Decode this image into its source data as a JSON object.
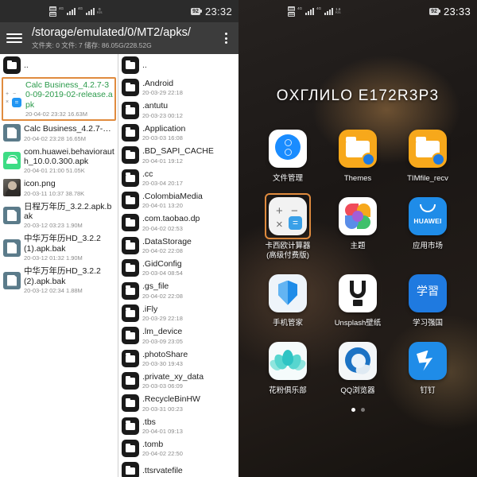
{
  "left_phone": {
    "status_bar": {
      "net_label_1": "4G",
      "net_label_2": "4G",
      "speed_value": "0",
      "speed_unit": "K/s",
      "battery": "92",
      "clock": "23:32"
    },
    "toolbar": {
      "menu_icon": "hamburger-icon",
      "path": "/storage/emulated/0/MT2/apks/",
      "subtitle": "文件夹: 0  文件: 7  储存: 86.05G/228.52G",
      "overflow_icon": "kebab-menu-icon"
    },
    "left_pane": {
      "items": [
        {
          "icon": "folder-icon",
          "icon_type": "folder",
          "name": "..",
          "date": "",
          "selected": false,
          "green": false
        },
        {
          "icon": "calculator-icon",
          "icon_type": "calc",
          "name": "Calc Business_4.2.7-30-09-2019-02-release.apk",
          "date": "20-04-02 23:32  16.63M",
          "selected": true,
          "green": true
        },
        {
          "icon": "document-icon",
          "icon_type": "doc",
          "name": "Calc Business_4.2.7-30-09...",
          "date": "20-04-02 23:28  16.65M",
          "selected": false,
          "green": false
        },
        {
          "icon": "android-apk-icon",
          "icon_type": "apk",
          "name": "com.huawei.behaviorauth_10.0.0.300.apk",
          "date": "20-04-01 21:00  51.05K",
          "selected": false,
          "green": false
        },
        {
          "icon": "image-icon",
          "icon_type": "img",
          "name": "icon.png",
          "date": "20-03-11 10:37  38.78K",
          "selected": false,
          "green": false
        },
        {
          "icon": "document-icon",
          "icon_type": "doc",
          "name": "日程万年历_3.2.2.apk.bak",
          "date": "20-03-12 03:23  1.90M",
          "selected": false,
          "green": false
        },
        {
          "icon": "document-icon",
          "icon_type": "doc",
          "name": "中华万年历HD_3.2.2 (1).apk.bak",
          "date": "20-03-12 01:32  1.90M",
          "selected": false,
          "green": false
        },
        {
          "icon": "document-icon",
          "icon_type": "doc",
          "name": "中华万年历HD_3.2.2 (2).apk.bak",
          "date": "20-03-12 02:34  1.88M",
          "selected": false,
          "green": false
        }
      ]
    },
    "right_pane": {
      "items": [
        {
          "icon": "folder-icon",
          "name": "..",
          "date": ""
        },
        {
          "icon": "folder-icon",
          "name": ".Android",
          "date": "20-03-29 22:18"
        },
        {
          "icon": "folder-icon",
          "name": ".antutu",
          "date": "20-03-23 00:12"
        },
        {
          "icon": "folder-icon",
          "name": ".Application",
          "date": "20-03-03 16:08"
        },
        {
          "icon": "folder-icon",
          "name": ".BD_SAPI_CACHE",
          "date": "20-04-01 19:12"
        },
        {
          "icon": "folder-icon",
          "name": ".cc",
          "date": "20-03-04 20:17"
        },
        {
          "icon": "folder-icon",
          "name": ".ColombiaMedia",
          "date": "20-04-01 13:20"
        },
        {
          "icon": "folder-icon",
          "name": ".com.taobao.dp",
          "date": "20-04-02 02:53"
        },
        {
          "icon": "folder-icon",
          "name": ".DataStorage",
          "date": "20-04-02 22:08"
        },
        {
          "icon": "folder-icon",
          "name": ".GidConfig",
          "date": "20-03-04 08:54"
        },
        {
          "icon": "folder-icon",
          "name": ".gs_file",
          "date": "20-04-02 22:08"
        },
        {
          "icon": "folder-icon",
          "name": ".iFly",
          "date": "20-03-29 22:18"
        },
        {
          "icon": "folder-icon",
          "name": ".lm_device",
          "date": "20-03-09 23:05"
        },
        {
          "icon": "folder-icon",
          "name": ".photoShare",
          "date": "20-03-30 19:43"
        },
        {
          "icon": "folder-icon",
          "name": ".private_xy_data",
          "date": "20-03-03 06:09"
        },
        {
          "icon": "folder-icon",
          "name": ".RecycleBinHW",
          "date": "20-03-31 00:23"
        },
        {
          "icon": "folder-icon",
          "name": ".tbs",
          "date": "20-04-01 09:13"
        },
        {
          "icon": "folder-icon",
          "name": ".tomb",
          "date": "20-04-02 22:50"
        },
        {
          "icon": "folder-icon",
          "name": ".ttsrvatefile",
          "date": ""
        }
      ]
    }
  },
  "right_phone": {
    "status_bar": {
      "net_label_1": "4G",
      "net_label_2": "4G",
      "speed_value": "1.6",
      "speed_unit": "K/s",
      "battery": "92",
      "clock": "23:33"
    },
    "widget_title": "OXГЛИLO E172R3P3",
    "apps": [
      {
        "label": "文件管理",
        "icon": "file-manager-icon",
        "kind": "filemgr",
        "highlighted": false
      },
      {
        "label": "Themes",
        "icon": "themes-folder-icon",
        "kind": "orange",
        "highlighted": false
      },
      {
        "label": "TIMfile_recv",
        "icon": "timfile-folder-icon",
        "kind": "orange",
        "highlighted": false
      },
      {
        "label": "卡西欧计算器\n(高级付费版)",
        "icon": "calculator-icon",
        "kind": "calc",
        "highlighted": true
      },
      {
        "label": "主题",
        "icon": "theme-swirl-icon",
        "kind": "theme",
        "highlighted": false
      },
      {
        "label": "应用市场",
        "icon": "huawei-appgallery-icon",
        "kind": "huawei",
        "highlighted": false
      },
      {
        "label": "手机管家",
        "icon": "shield-icon",
        "kind": "shield",
        "highlighted": false
      },
      {
        "label": "Unsplash壁纸",
        "icon": "unsplash-icon",
        "kind": "unsplash",
        "highlighted": false
      },
      {
        "label": "学习强国",
        "icon": "xuexi-icon",
        "kind": "xuexi",
        "highlighted": false,
        "glyph": "学習"
      },
      {
        "label": "花粉俱乐部",
        "icon": "lotus-icon",
        "kind": "lotus",
        "highlighted": false
      },
      {
        "label": "QQ浏览器",
        "icon": "qq-browser-icon",
        "kind": "qq",
        "highlighted": false
      },
      {
        "label": "钉钉",
        "icon": "dingtalk-icon",
        "kind": "dd",
        "highlighted": false
      }
    ],
    "huawei_icon_text": "HUAWEI",
    "calc_glyphs": {
      "plus": "+",
      "minus": "−",
      "times": "×",
      "equals": "="
    },
    "page_indicator": {
      "count": 2,
      "active": 0
    }
  },
  "colors": {
    "accent_orange": "#e08b3e",
    "toolbar_bg": "#3c3c3c",
    "statusbar_bg": "#2b2b2b",
    "selected_filename_green": "#2a9a4a"
  }
}
